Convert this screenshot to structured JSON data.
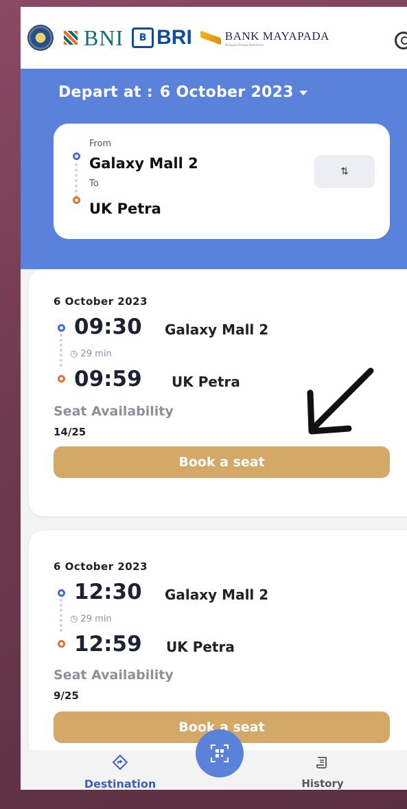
{
  "header": {
    "logos": [
      "gov-seal",
      "BNI",
      "BRI",
      "BANK MAYAPADA"
    ],
    "bni_text": "BNI",
    "bri_text": "BRI",
    "mayapada_text": "BANK MAYAPADA",
    "mayapada_sub": "Melayani Dengan Komitmen"
  },
  "depart": {
    "label": "Depart at :",
    "date": "6 October 2023"
  },
  "route": {
    "from_label": "From",
    "from": "Galaxy Mall 2",
    "to_label": "To",
    "to": "UK Petra",
    "swap_icon": "⇅"
  },
  "trips": [
    {
      "date": "6 October 2023",
      "depart_time": "09:30",
      "depart_stop": "Galaxy Mall 2",
      "duration": "29 min",
      "arrive_time": "09:59",
      "arrive_stop": "UK Petra",
      "seat_title": "Seat Availability",
      "seats": "14/25",
      "button": "Book a seat"
    },
    {
      "date": "6 October 2023",
      "depart_time": "12:30",
      "depart_stop": "Galaxy Mall 2",
      "duration": "29 min",
      "arrive_time": "12:59",
      "arrive_stop": "UK Petra",
      "seat_title": "Seat Availability",
      "seats": "9/25",
      "button": "Book a seat"
    }
  ],
  "nav": {
    "destination": "Destination",
    "history": "History",
    "scan_icon": "qr-scan-icon"
  },
  "colors": {
    "primary": "#5b82db",
    "button": "#d4a866",
    "from_dot": "#3b6fd6",
    "to_dot": "#e5712e"
  }
}
